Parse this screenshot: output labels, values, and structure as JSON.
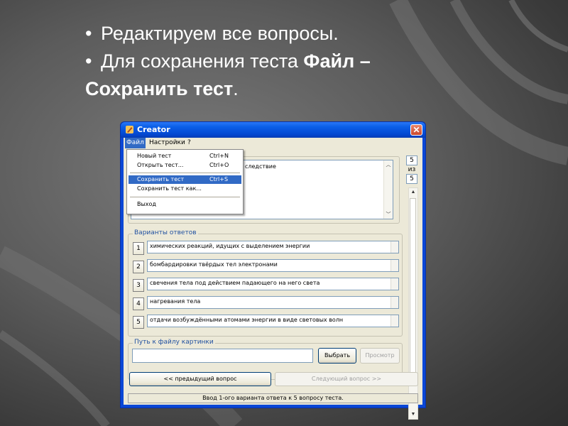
{
  "slide": {
    "bullet_char": "•",
    "line1": "Редактируем все вопросы.",
    "line2_prefix": "Для сохранения теста ",
    "line2_bold": "Файл –",
    "line3_bold": "Сохранить тест",
    "line3_suffix": "."
  },
  "window": {
    "title": "Creator",
    "close": "✕",
    "icon": "pencil-icon"
  },
  "menubar": {
    "file": "Файл",
    "settings": "Настройки",
    "help": "?"
  },
  "dropdown": {
    "items": [
      {
        "label": "Новый тест",
        "shortcut": "Ctrl+N"
      },
      {
        "label": "Открыть тест...",
        "shortcut": "Ctrl+O"
      },
      {
        "label": "Сохранить тест",
        "shortcut": "Ctrl+S"
      },
      {
        "label": "Сохранить тест как...",
        "shortcut": ""
      },
      {
        "label": "Выход",
        "shortcut": ""
      }
    ]
  },
  "question": {
    "text_visible": "следствие"
  },
  "counter": {
    "current": "5",
    "of": "из",
    "total": "5"
  },
  "answers": {
    "group_title": "Варианты ответов",
    "items": [
      {
        "num": "1",
        "text": "химических реакций, идущих с выделением энергии"
      },
      {
        "num": "2",
        "text": "бомбардировки твёрдых тел электронами"
      },
      {
        "num": "3",
        "text": "свечения тела под действием падающего на него света"
      },
      {
        "num": "4",
        "text": "нагревания тела"
      },
      {
        "num": "5",
        "text": "отдачи возбуждёнными атомами энергии в виде световых волн"
      }
    ]
  },
  "image_path": {
    "group_title": "Путь к файлу картинки",
    "value": "",
    "browse": "Выбрать",
    "preview": "Просмотр"
  },
  "nav": {
    "prev": "<< предыдущий вопрос",
    "next": "Следующий вопрос >>"
  },
  "status": "Ввод 1-ого варианта ответа к 5 вопросу теста."
}
